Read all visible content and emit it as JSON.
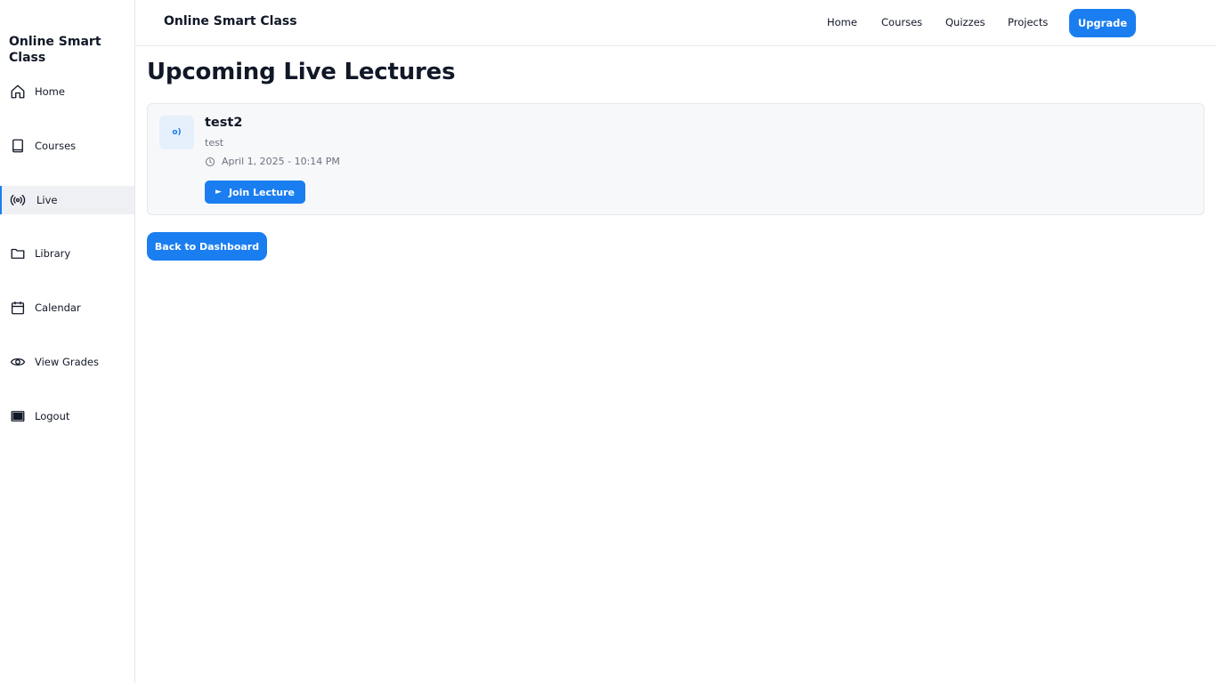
{
  "sidebar": {
    "brand": "Online Smart Class",
    "items": [
      {
        "label": "Home",
        "icon": "home-icon"
      },
      {
        "label": "Courses",
        "icon": "book-icon"
      },
      {
        "label": "Live",
        "icon": "broadcast-icon",
        "active": true
      },
      {
        "label": "Library",
        "icon": "folder-icon"
      },
      {
        "label": "Calendar",
        "icon": "calendar-icon"
      },
      {
        "label": "View Grades",
        "icon": "eye-icon"
      },
      {
        "label": "Logout",
        "icon": "logout-icon"
      }
    ]
  },
  "topbar": {
    "title": "Online Smart Class",
    "nav": [
      "Home",
      "Courses",
      "Quizzes",
      "Projects"
    ],
    "upgrade_label": "Upgrade"
  },
  "main": {
    "title": "Upcoming Live Lectures",
    "lectures": [
      {
        "icon_text": "o)",
        "title": "test2",
        "description": "test",
        "datetime": "April 1, 2025 - 10:14 PM",
        "join_label": "Join Lecture",
        "join_icon": "►"
      }
    ],
    "back_label": "Back to Dashboard"
  },
  "colors": {
    "accent": "#1a7ef0",
    "active_bg": "#eef0f4",
    "card_bg": "#f7f8fa",
    "icon_box_bg": "#e6effc"
  }
}
